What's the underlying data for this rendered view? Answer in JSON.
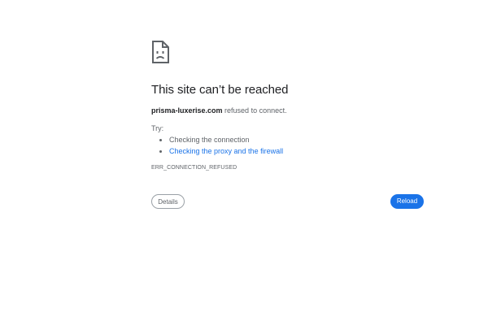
{
  "error_page": {
    "icon": "sad-page-icon",
    "title": "This site can’t be reached",
    "host": "prisma-luxerise.com",
    "refused_text": " refused to connect.",
    "try_label": "Try:",
    "suggestions": [
      {
        "label": "Checking the connection",
        "is_link": false
      },
      {
        "label": "Checking the proxy and the firewall",
        "is_link": true
      }
    ],
    "error_code": "ERR_CONNECTION_REFUSED"
  },
  "buttons": {
    "details_label": "Details",
    "reload_label": "Reload"
  },
  "colors": {
    "accent": "#1a73e8",
    "text": "#202124",
    "secondary_text": "#5f6368"
  }
}
